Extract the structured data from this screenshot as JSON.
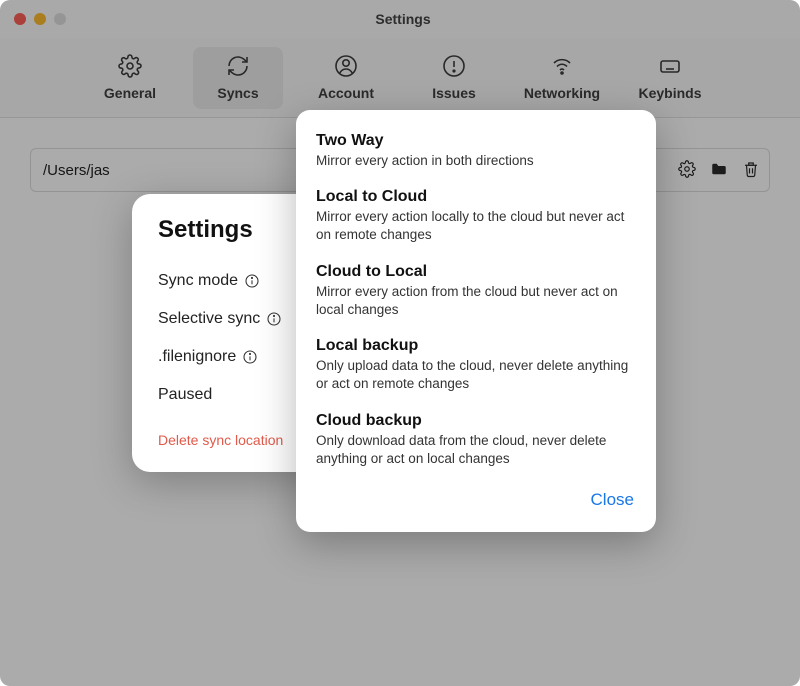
{
  "window": {
    "title": "Settings"
  },
  "tabs": [
    {
      "id": "general",
      "label": "General"
    },
    {
      "id": "syncs",
      "label": "Syncs"
    },
    {
      "id": "account",
      "label": "Account"
    },
    {
      "id": "issues",
      "label": "Issues"
    },
    {
      "id": "networking",
      "label": "Networking"
    },
    {
      "id": "keybinds",
      "label": "Keybinds"
    }
  ],
  "active_tab": "syncs",
  "sync_location": {
    "path": "/Users/jas"
  },
  "settings_modal": {
    "title": "Settings",
    "rows": {
      "sync_mode": "Sync mode",
      "selective_sync": "Selective sync",
      "filenignore": ".filenignore",
      "paused": "Paused"
    },
    "delete_label": "Delete sync location"
  },
  "sync_modes": [
    {
      "title": "Two Way",
      "desc": "Mirror every action in both directions"
    },
    {
      "title": "Local to Cloud",
      "desc": "Mirror every action locally to the cloud but never act on remote changes"
    },
    {
      "title": "Cloud to Local",
      "desc": "Mirror every action from the cloud but never act on local changes"
    },
    {
      "title": "Local backup",
      "desc": "Only upload data to the cloud, never delete anything or act on remote changes"
    },
    {
      "title": "Cloud backup",
      "desc": "Only download data from the cloud, never delete anything or act on local changes"
    }
  ],
  "popover": {
    "close_label": "Close"
  }
}
